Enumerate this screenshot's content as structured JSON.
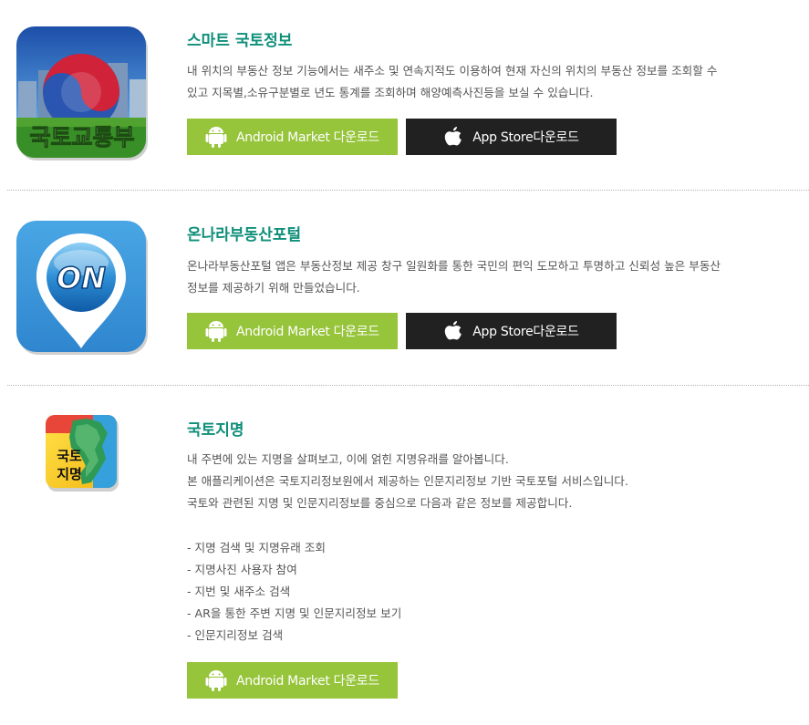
{
  "apps": [
    {
      "title": "스마트 국토정보",
      "icon_name": "molit-app-icon",
      "icon_text": "국토교통부",
      "description_lines": [
        "내 위치의 부동산 정보 기능에서는 새주소 및 연속지적도 이용하여 현재 자신의 위치의 부동산 정보를 조회할 수",
        "있고 지목별,소유구분별로 년도 통계를 조회하며 해양예측사진등을 보실 수 있습니다."
      ],
      "android_label": "Android Market 다운로드",
      "appstore_label": "App Store다운로드"
    },
    {
      "title": "온나라부동산포털",
      "icon_name": "onnara-app-icon",
      "icon_text": "ON",
      "description_lines": [
        "온나라부동산포털 앱은 부동산정보 제공 창구 일원화를 통한 국민의 편익 도모하고 투명하고 신뢰성 높은 부동산",
        "정보를 제공하기 위해 만들었습니다."
      ],
      "android_label": "Android Market 다운로드",
      "appstore_label": "App Store다운로드"
    },
    {
      "title": "국토지명",
      "icon_name": "korea-placename-app-icon",
      "icon_text_line1": "국토",
      "icon_text_line2": "지명",
      "description_lines": [
        "내 주변에 있는 지명을 살펴보고, 이에 얽힌 지명유래를 알아봅니다.",
        "본 애플리케이션은 국토지리정보원에서 제공하는 인문지리정보 기반 국토포털 서비스입니다.",
        "국토와 관련된 지명 및 인문지리정보를 중심으로 다음과 같은 정보를 제공합니다."
      ],
      "features": [
        "- 지명 검색 및 지명유래 조회",
        "- 지명사진 사용자 참여",
        "- 지번 및 새주소 검색",
        "- AR을 통한 주변 지명 및 인문지리정보 보기",
        "- 인문지리정보 검색"
      ],
      "android_label": "Android Market 다운로드"
    }
  ],
  "colors": {
    "title": "#0f8f7a",
    "android_button": "#96c43a",
    "appstore_button": "#212121",
    "divider": "#b5b5b5"
  },
  "icons": {
    "android": "android-robot-icon",
    "apple": "apple-logo-icon"
  }
}
